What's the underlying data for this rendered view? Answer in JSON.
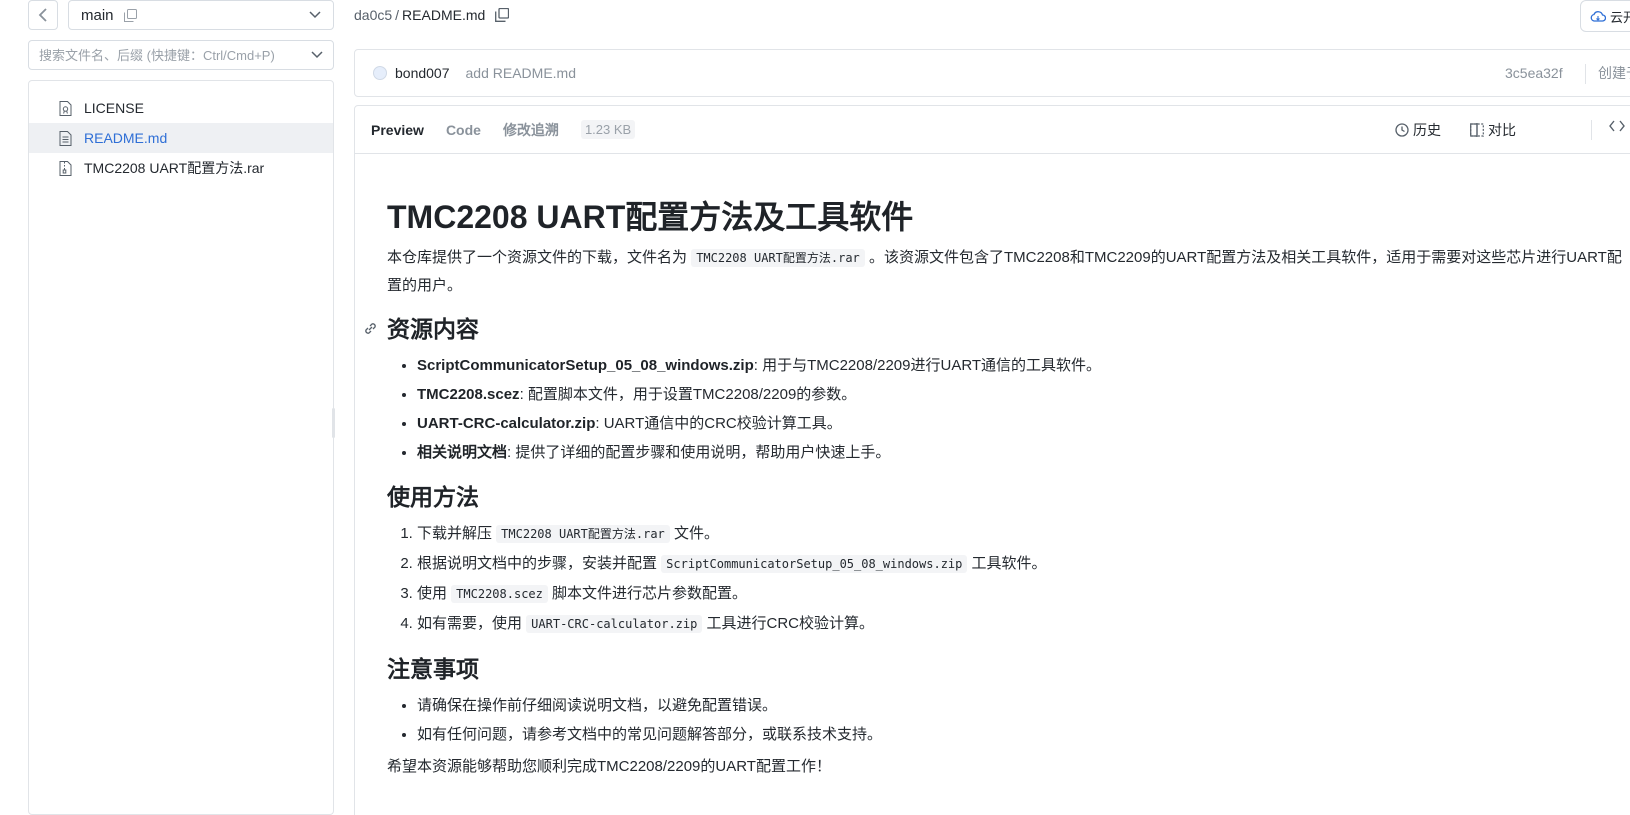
{
  "sidebar": {
    "branch": "main",
    "search_placeholder": "搜索文件名、后缀 (快捷键：Ctrl/Cmd+P)",
    "files": [
      {
        "name": "LICENSE",
        "icon": "license-file-icon",
        "active": false
      },
      {
        "name": "README.md",
        "icon": "document-file-icon",
        "active": true
      },
      {
        "name": "TMC2208 UART配置方法.rar",
        "icon": "archive-file-icon",
        "active": false
      }
    ]
  },
  "header": {
    "commit_hash_short": "da0c5",
    "separator": "/",
    "file_name": "README.md",
    "cloud_button": "云开"
  },
  "commit": {
    "author": "bond007",
    "message": "add README.md",
    "hash": "3c5ea32f",
    "created": "创建于"
  },
  "viewer": {
    "tabs": [
      "Preview",
      "Code",
      "修改追溯"
    ],
    "active_tab": "Preview",
    "file_size": "1.23 KB",
    "history_label": "历史",
    "compare_label": "对比"
  },
  "readme": {
    "title": "TMC2208 UART配置方法及工具软件",
    "intro_before": "本仓库提供了一个资源文件的下载，文件名为",
    "intro_code": "TMC2208 UART配置方法.rar",
    "intro_after": "。该资源文件包含了TMC2208和TMC2209的UART配置方法及相关工具软件，适用于需要对这些芯片进行UART配置的用户。",
    "section1_title": "资源内容",
    "resources": [
      {
        "name": "ScriptCommunicatorSetup_05_08_windows.zip",
        "desc": ": 用于与TMC2208/2209进行UART通信的工具软件。"
      },
      {
        "name": "TMC2208.scez",
        "desc": ": 配置脚本文件，用于设置TMC2208/2209的参数。"
      },
      {
        "name": "UART-CRC-calculator.zip",
        "desc": ": UART通信中的CRC校验计算工具。"
      },
      {
        "name": "相关说明文档",
        "desc": ": 提供了详细的配置步骤和使用说明，帮助用户快速上手。"
      }
    ],
    "section2_title": "使用方法",
    "steps": [
      {
        "before": "下载并解压 ",
        "code": "TMC2208 UART配置方法.rar",
        "after": " 文件。"
      },
      {
        "before": "根据说明文档中的步骤，安装并配置 ",
        "code": "ScriptCommunicatorSetup_05_08_windows.zip",
        "after": " 工具软件。"
      },
      {
        "before": "使用 ",
        "code": "TMC2208.scez",
        "after": " 脚本文件进行芯片参数配置。"
      },
      {
        "before": "如有需要，使用 ",
        "code": "UART-CRC-calculator.zip",
        "after": " 工具进行CRC校验计算。"
      }
    ],
    "section3_title": "注意事项",
    "notes": [
      "请确保在操作前仔细阅读说明文档，以避免配置错误。",
      "如有任何问题，请参考文档中的常见问题解答部分，或联系技术支持。"
    ],
    "closing": "希望本资源能够帮助您顺利完成TMC2208/2209的UART配置工作！"
  },
  "colors": {
    "accent": "#2f6fd6",
    "border": "#e1e4e8",
    "muted_text": "#8a929b"
  }
}
